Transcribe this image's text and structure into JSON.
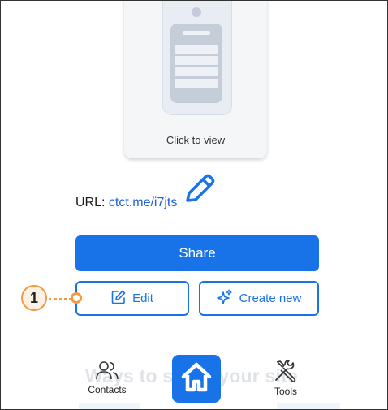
{
  "preview": {
    "caption": "Click to view"
  },
  "url": {
    "label": "URL:",
    "link": "ctct.me/i7jts"
  },
  "actions": {
    "share_label": "Share",
    "edit_label": "Edit",
    "create_label": "Create new"
  },
  "callout": {
    "number": "1"
  },
  "background_heading": "Ways to share your site",
  "nav": {
    "contacts_label": "Contacts",
    "tools_label": "Tools"
  },
  "colors": {
    "primary": "#1873e8",
    "callout": "#f39a45",
    "link": "#1f5fd6"
  },
  "icons": [
    "pencil-icon",
    "edit-icon",
    "sparkle-icon",
    "contacts-icon",
    "home-icon",
    "tools-icon"
  ]
}
